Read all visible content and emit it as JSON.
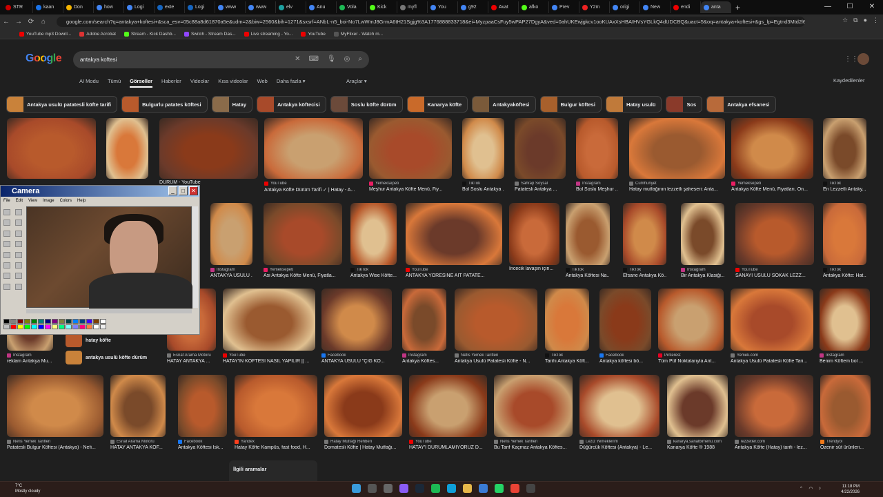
{
  "browser": {
    "tabs": [
      {
        "label": "STR",
        "color": "#c00"
      },
      {
        "label": "kaan",
        "color": "#1a73e8"
      },
      {
        "label": "Don",
        "color": "#f4b400"
      },
      {
        "label": "how",
        "color": "#4285f4"
      },
      {
        "label": "Logi",
        "color": "#4285f4"
      },
      {
        "label": "exte",
        "color": "#1565c0"
      },
      {
        "label": "Logi",
        "color": "#1565c0"
      },
      {
        "label": "www",
        "color": "#4285f4"
      },
      {
        "label": "www",
        "color": "#4285f4"
      },
      {
        "label": "elv",
        "color": "#1da1a1"
      },
      {
        "label": "Anu",
        "color": "#4285f4"
      },
      {
        "label": "Vola",
        "color": "#1db954"
      },
      {
        "label": "Kick",
        "color": "#53fc18"
      },
      {
        "label": "myfl",
        "color": "#777"
      },
      {
        "label": "You",
        "color": "#4285f4"
      },
      {
        "label": "g92",
        "color": "#4285f4"
      },
      {
        "label": "Avat",
        "color": "#e00"
      },
      {
        "label": "afko",
        "color": "#53fc18"
      },
      {
        "label": "Prev",
        "color": "#4285f4"
      },
      {
        "label": "Y2m",
        "color": "#e22"
      },
      {
        "label": "origi",
        "color": "#4285f4"
      },
      {
        "label": "New",
        "color": "#4285f4"
      },
      {
        "label": "endi",
        "color": "#e00"
      },
      {
        "label": "anta",
        "color": "#4285f4"
      }
    ],
    "url": "google.com/search?q=antakya+koftesi+&sca_esv=05c88a8d61870a5e&udm=2&biw=2560&bih=1271&sxsrf=ANbL-n5_boi-No7LwWmJ8GrmA6tH21Sgjg%3A1776888833718&ei=MyzpaaCsFuy5wPAP27DgyA&ved=0ahUKEwjgkcv1ooKUAxXsHBAIHVsYGLkQ4dUDCBQ&uact=5&oq=antakya+koftesi+&gs_lp=Egtnd3Mtd2l6LWltZyIQYW50YWt5YSBra...",
    "bookmarks": [
      "YouTube mp3 Downl...",
      "Adobe Acrobat",
      "Stream - Kick Dashb...",
      "Switch - Stream Das...",
      "Live streaming - Yo...",
      "YouTube",
      "MyFlixer - Watch m..."
    ]
  },
  "google": {
    "logo": "Google",
    "query": "antakya koftesi",
    "filters": [
      "AI Modu",
      "Tümü",
      "Görseller",
      "Haberler",
      "Videolar",
      "Kısa videolar",
      "Web",
      "Daha fazla ▾"
    ],
    "active_filter_index": 2,
    "tools": "Araçlar ▾",
    "saved": "Kaydedilenler",
    "chips": [
      "Antakya usulü patatesli köfte tarifi",
      "Bulgurlu patates köftesi",
      "Hatay",
      "Antakya köftecisi",
      "Soslu köfte dürüm",
      "Kanarya köfte",
      "Antakyaköftesi",
      "Bulgur köftesi",
      "Hatay usulü",
      "Sos",
      "Antakya efsanesi"
    ]
  },
  "results": {
    "row1": [
      {
        "src": "",
        "cap": ""
      },
      {
        "src": "",
        "cap": ""
      },
      {
        "src": "",
        "cap": "DÜRÜM - YouTube"
      },
      {
        "src": "YouTube",
        "cap": "Antakya Köfte Dürüm Tarifi ✓ | Hatay - A..."
      },
      {
        "src": "Yemeksepeti",
        "cap": "Meşhur Antakya Köfte Menü, Fiy..."
      },
      {
        "src": "TikTok",
        "cap": "Bol Soslu Antakya ..."
      },
      {
        "src": "Sahrap Soysal",
        "cap": "Patatesli Antakya ..."
      },
      {
        "src": "Instagram",
        "cap": "Bol Soslu Meşhur ..."
      },
      {
        "src": "Cumhuriyet",
        "cap": "Hatay mutfağının lezzetli şaheseri: Anta..."
      },
      {
        "src": "Yemeksepeti",
        "cap": "Antakya Köfte Menü, Fiyatları, On..."
      },
      {
        "src": "TikTok",
        "cap": "En Lezzetli Antaky..."
      }
    ],
    "row2": [
      {
        "src": "Instagram",
        "cap": "ANTAKYA USULÜ ..."
      },
      {
        "src": "Yemeksepeti",
        "cap": "Asi Antakya Köfte Menü, Fiyatla..."
      },
      {
        "src": "TikTok",
        "cap": "Antakya Wise Köfte..."
      },
      {
        "src": "YouTube",
        "cap": "ANTAKYA YÖRESİNE AİT PATATE..."
      },
      {
        "src": "",
        "cap": "İncecik lavaşın için..."
      },
      {
        "src": "TikTok",
        "cap": "Antakya Köftesi Na..."
      },
      {
        "src": "TikTok",
        "cap": "Efsane Antakya Kö..."
      },
      {
        "src": "Instagram",
        "cap": "Bir Antakya Klasiği..."
      },
      {
        "src": "YouTube",
        "cap": "SANAYİ USULÜ SOKAK LEZZ..."
      },
      {
        "src": "TikTok",
        "cap": "Antakya Köfte: Hat..."
      }
    ],
    "row3": [
      {
        "src": "Instagram",
        "cap": "reklam Antakya Mu..."
      },
      {
        "src": "Esnaf Arama Motoru",
        "cap": "HATAY ANTAKYA ..."
      },
      {
        "src": "YouTube",
        "cap": "HATAY'IN KÖFTESİ NASIL YAPILIR || ..."
      },
      {
        "src": "Facebook",
        "cap": "ANTAKYA USULÜ \"ÇİĞ KÖ..."
      },
      {
        "src": "Instagram",
        "cap": "Antakya Köftes..."
      },
      {
        "src": "Nefis Yemek Tarifleri",
        "cap": "Antakya Usulü Patatesli Köfte - N..."
      },
      {
        "src": "TikTok",
        "cap": "Tarihi Antakya Köft..."
      },
      {
        "src": "Facebook",
        "cap": "Antakya köftesi bö..."
      },
      {
        "src": "Pinterest",
        "cap": "Tüm Püf Noktalarıyla Ant..."
      },
      {
        "src": "Yemek.com",
        "cap": "Antakya Usulü Patatesli Köfte Tari..."
      },
      {
        "src": "Instagram",
        "cap": "Benim Köftem bol ..."
      }
    ],
    "row4": [
      {
        "src": "Nefis Yemek Tarifleri",
        "cap": "Patatesli Bulgur Köftesi (Antakya) - Nefi..."
      },
      {
        "src": "Esnaf Arama Motoru",
        "cap": "HATAY ANTAKYA KÖF..."
      },
      {
        "src": "Facebook",
        "cap": "Antakya Köftesi İsk..."
      },
      {
        "src": "Yandex",
        "cap": "Hatay Köfte Kampüs, fast food, H..."
      },
      {
        "src": "Hatay Mutfağı Rehberi",
        "cap": "Domatesli Köfte | Hatay Mutfağı..."
      },
      {
        "src": "YouTube",
        "cap": "HATAY'I DÜRÜMLAMIYORUZ D..."
      },
      {
        "src": "Nefis Yemek Tarifleri",
        "cap": "Bu Tarif Kaçmaz Antakya Köftes..."
      },
      {
        "src": "Leziz Yemeklerim",
        "cap": "Düğürcük Köftesi (Antakya) - Le..."
      },
      {
        "src": "kanarya.sanalbimenu.com",
        "cap": "Kanarya Köfte ® 1988"
      },
      {
        "src": "lezzetler.com",
        "cap": "Antakya Köfte (Hatay) tarifi - lez..."
      },
      {
        "src": "Trendyol",
        "cap": "Özenir süt ürünleri..."
      }
    ],
    "suggestions": [
      "hatay köfte",
      "antakya usulü köfte dürüm"
    ],
    "related": "İlgili aramalar"
  },
  "camera": {
    "title": "Camera",
    "menu": [
      "File",
      "Edit",
      "View",
      "Image",
      "Colors",
      "Help"
    ]
  },
  "taskbar": {
    "temp": "7°C",
    "weather": "Mostly cloudy",
    "time": "11:18 PM",
    "date": "4/22/2026"
  }
}
